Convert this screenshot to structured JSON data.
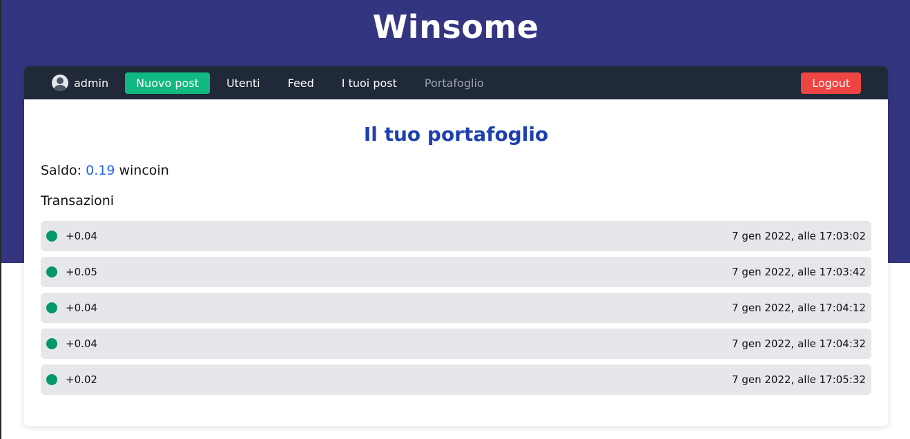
{
  "app": {
    "title": "Winsome"
  },
  "nav": {
    "user": "admin",
    "links": [
      "Nuovo post",
      "Utenti",
      "Feed",
      "I tuoi post",
      "Portafoglio"
    ],
    "logout": "Logout"
  },
  "wallet": {
    "title": "Il tuo portafoglio",
    "balance_label": "Saldo:",
    "balance_value": "0.19",
    "balance_unit": "wincoin",
    "transactions_label": "Transazioni",
    "transactions": [
      {
        "amount": "+0.04",
        "date": "7 gen 2022, alle 17:03:02"
      },
      {
        "amount": "+0.05",
        "date": "7 gen 2022, alle 17:03:42"
      },
      {
        "amount": "+0.04",
        "date": "7 gen 2022, alle 17:04:12"
      },
      {
        "amount": "+0.04",
        "date": "7 gen 2022, alle 17:04:32"
      },
      {
        "amount": "+0.02",
        "date": "7 gen 2022, alle 17:05:32"
      }
    ]
  },
  "colors": {
    "header_bg": "#343580",
    "navbar_bg": "#1f2937",
    "primary_button": "#10b981",
    "logout_button": "#ef4444",
    "title_blue": "#1e40af",
    "positive_dot": "#059669"
  }
}
